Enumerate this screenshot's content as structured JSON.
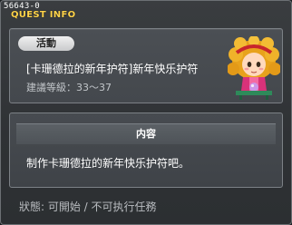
{
  "quest_id": "56643-0",
  "window_title": "QUEST INFO",
  "tag": "活動",
  "quest_name": "[卡珊德拉的新年护符]新年快乐护符",
  "recommended_level": "建議等級：33～37",
  "section_header": "内容",
  "description": "制作卡珊德拉的新年快乐护符吧。",
  "status": "狀態: 可開始 / 不可执行任務",
  "npc": {
    "icon": "npc-portrait-icon"
  }
}
